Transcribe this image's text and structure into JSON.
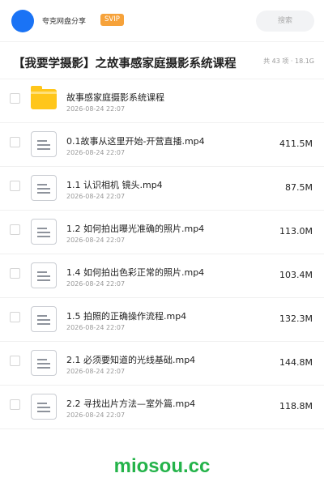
{
  "header": {
    "username": "夸克网盘分享",
    "badge": "SVIP",
    "search_placeholder": "搜索"
  },
  "folder_title": "【我要学摄影】之故事感家庭摄影系统课程",
  "summary": "共 43 项 · 18.1G",
  "files": [
    {
      "type": "folder",
      "icon": "folder-icon",
      "name": "故事感家庭摄影系统课程",
      "date": "2026-08-24 22:07",
      "size": ""
    },
    {
      "type": "video",
      "icon": "document-icon",
      "name": "0.1故事从这里开始-开营直播.mp4",
      "date": "2026-08-24 22:07",
      "size": "411.5M"
    },
    {
      "type": "video",
      "icon": "document-icon",
      "name": "1.1 认识相机 镜头.mp4",
      "date": "2026-08-24 22:07",
      "size": "87.5M"
    },
    {
      "type": "video",
      "icon": "document-icon",
      "name": "1.2 如何拍出曝光准确的照片.mp4",
      "date": "2026-08-24 22:07",
      "size": "113.0M"
    },
    {
      "type": "video",
      "icon": "document-icon",
      "name": "1.4 如何拍出色彩正常的照片.mp4",
      "date": "2026-08-24 22:07",
      "size": "103.4M"
    },
    {
      "type": "video",
      "icon": "document-icon",
      "name": "1.5 拍照的正确操作流程.mp4",
      "date": "2026-08-24 22:07",
      "size": "132.3M"
    },
    {
      "type": "video",
      "icon": "document-icon",
      "name": "2.1 必须要知道的光线基础.mp4",
      "date": "2026-08-24 22:07",
      "size": "144.8M"
    },
    {
      "type": "video",
      "icon": "document-icon",
      "name": "2.2 寻找出片方法—室外篇.mp4",
      "date": "2026-08-24 22:07",
      "size": "118.8M"
    }
  ],
  "watermark": "miosou.cc",
  "colors": {
    "accent": "#1a73f5",
    "badge": "#f6a23a",
    "folder": "#ffc61a",
    "watermark": "#24b34a"
  }
}
